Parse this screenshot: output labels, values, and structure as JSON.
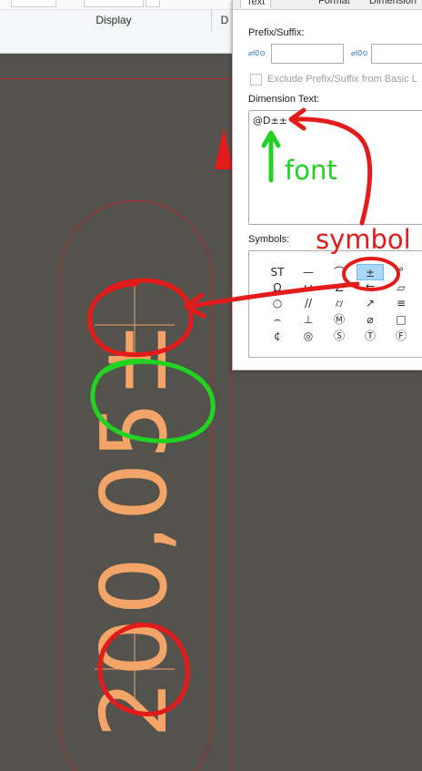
{
  "ribbon": {
    "group_display": "Display",
    "group_next_partial": "D"
  },
  "dialog": {
    "tab_text": "Text",
    "tab_format": "Format",
    "tab_dimension": "Dimension",
    "prefix_suffix_label": "Prefix/Suffix:",
    "prefix_icon": "⌀I0⊙",
    "suffix_icon": "⌀I0⊙",
    "exclude_label": "Exclude Prefix/Suffix from Basic L",
    "dimension_text_label": "Dimension Text:",
    "dimension_text_value": "@D±±",
    "symbols_label": "Symbols:"
  },
  "symbols": [
    [
      "ST",
      "—",
      "⌒",
      "±",
      "°"
    ],
    [
      "Ω",
      "ω",
      "∠",
      "⇆",
      "▱"
    ],
    [
      "○",
      "//",
      "⌭",
      "↗",
      "≡"
    ],
    [
      "⌢",
      "⊥",
      "Ⓜ",
      "⌀",
      "□"
    ],
    [
      "¢",
      "◎",
      "Ⓢ",
      "Ⓣ",
      "Ⓕ"
    ]
  ],
  "selected_symbol": "±",
  "drawing": {
    "dimension_text": "200,05±"
  },
  "annotations": {
    "font_label": "font",
    "symbol_label": "symbol"
  },
  "colors": {
    "background": "#54524c",
    "dimension_color": "#f3a468",
    "border_red": "#b3262a",
    "annotation_red": "#e41b1b",
    "annotation_green": "#22d322",
    "selected_symbol_bg": "#a9d7f7"
  }
}
